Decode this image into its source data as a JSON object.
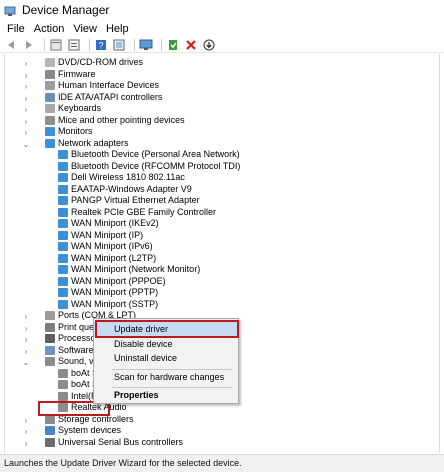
{
  "window": {
    "title": "Device Manager"
  },
  "menu": {
    "items": [
      "File",
      "Action",
      "View",
      "Help"
    ]
  },
  "toolbar": {
    "icons": [
      "back-icon",
      "forward-icon",
      "show-hide-icon",
      "properties-icon",
      "help-icon",
      "scan-icon",
      "monitor-icon",
      "update-driver-icon",
      "uninstall-icon",
      "download-icon"
    ]
  },
  "tree": {
    "categories_top": [
      "DVD/CD-ROM drives",
      "Firmware",
      "Human Interface Devices",
      "IDE ATA/ATAPI controllers",
      "Keyboards",
      "Mice and other pointing devices",
      "Monitors",
      "Network adapters"
    ],
    "network_adapters": [
      "Bluetooth Device (Personal Area Network)",
      "Bluetooth Device (RFCOMM Protocol TDI)",
      "Dell Wireless 1810 802.11ac",
      "EAATAP-Windows Adapter V9",
      "PANGP Virtual Ethernet Adapter",
      "Realtek PCIe GBE Family Controller",
      "WAN Miniport (IKEv2)",
      "WAN Miniport (IP)",
      "WAN Miniport (IPv6)",
      "WAN Miniport (L2TP)",
      "WAN Miniport (Network Monitor)",
      "WAN Miniport (PPPOE)",
      "WAN Miniport (PPTP)",
      "WAN Miniport (SSTP)"
    ],
    "categories_mid": [
      "Ports (COM & LPT)",
      "Print queues",
      "Processors",
      "Software dev",
      "Sound, video"
    ],
    "sound_children": [
      "boAt STON",
      "boAt STON",
      "Intel(R) Di",
      "Realtek Audio"
    ],
    "categories_bottom": [
      "Storage controllers",
      "System devices",
      "Universal Serial Bus controllers"
    ]
  },
  "context_menu": {
    "items": [
      "Update driver",
      "Disable device",
      "Uninstall device",
      "Scan for hardware changes",
      "Properties"
    ]
  },
  "status": {
    "text": "Launches the Update Driver Wizard for the selected device."
  },
  "colors": {
    "highlight": "#c5dcf2",
    "annotation": "#c0181d",
    "network_icon": "#3d8fd6"
  }
}
